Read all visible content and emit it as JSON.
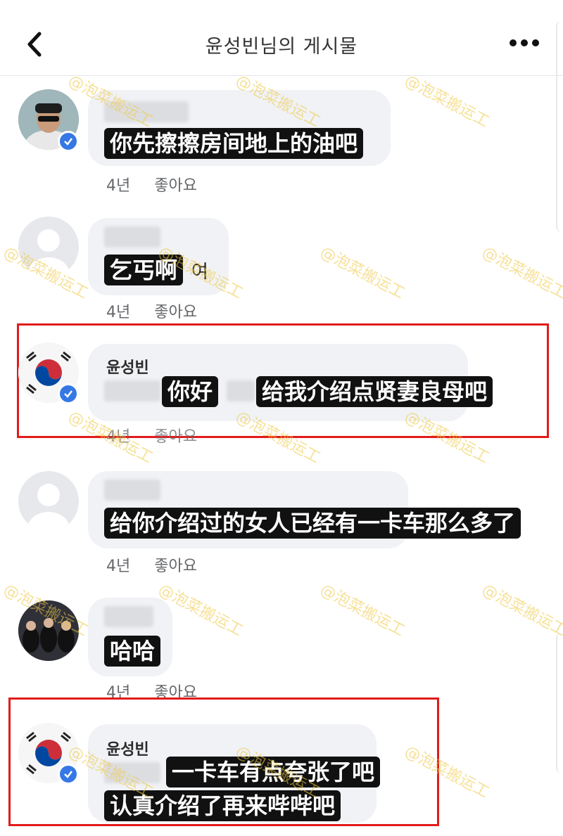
{
  "header": {
    "title": "윤성빈님의 게시물",
    "back_icon": "chevron-left-icon",
    "more_icon": "more-horizontal-icon"
  },
  "comments": [
    {
      "author": "",
      "subtitle": "你先擦擦房间地上的油吧",
      "overlap_text": "",
      "time": "4년",
      "like": "좋아요",
      "verified": true
    },
    {
      "author": "",
      "subtitle": "乞丐啊",
      "overlap_text": "여",
      "time": "4년",
      "like": "좋아요",
      "verified": false
    },
    {
      "author": "윤성빈",
      "subtitle": "你好",
      "subtitle_2": "给我介绍点贤妻良母吧",
      "time": "4년",
      "like": "좋아요",
      "verified": true,
      "highlighted": true
    },
    {
      "author": "",
      "subtitle": "给你介绍过的女人已经有一卡车那么多了",
      "time": "4년",
      "like": "좋아요",
      "verified": false
    },
    {
      "author": "",
      "subtitle": "哈哈",
      "time": "4년",
      "like": "좋아요",
      "verified": false
    },
    {
      "author": "윤성빈",
      "subtitle": "一卡车有点夸张了吧",
      "subtitle_2": "认真介绍了再来哔哔吧",
      "verified": true,
      "highlighted": true
    }
  ],
  "watermark": "@泡菜搬运工",
  "colors": {
    "verify_blue": "#3578e5",
    "highlight_red": "#e21b1b",
    "bubble_gray": "#f0f2f5"
  }
}
